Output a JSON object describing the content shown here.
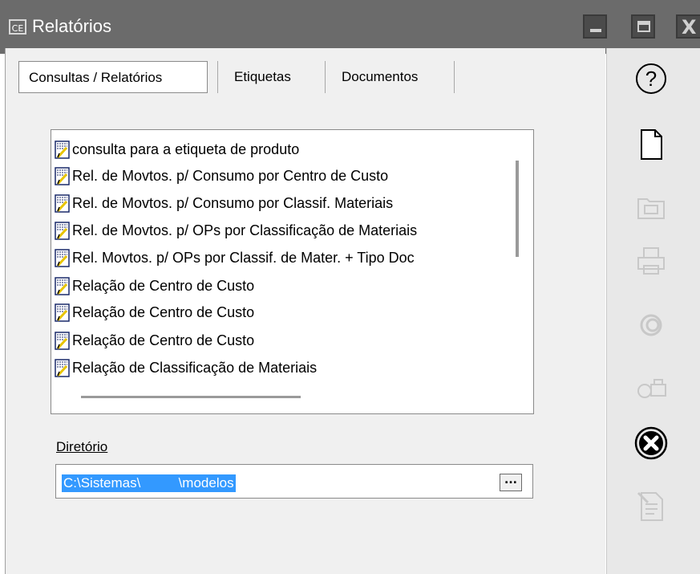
{
  "window": {
    "app_badge": "CE",
    "title": "Relatórios",
    "min_icon": "minimize-icon",
    "max_icon": "maximize-icon",
    "close_icon": "close-icon",
    "close_glyph": "X"
  },
  "tabs": [
    {
      "label": "Consultas / Relatórios",
      "active": true
    },
    {
      "label": "Etiquetas",
      "active": false
    },
    {
      "label": "Documentos",
      "active": false
    }
  ],
  "report_list": {
    "item_icon": "report-document-icon",
    "items": [
      "consulta para a etiqueta de produto",
      "Rel. de Movtos. p/ Consumo por Centro de Custo",
      "Rel. de Movtos. p/ Consumo por Classif. Materiais",
      "Rel. de Movtos. p/ OPs por Classificação de Materiais",
      "Rel. Movtos. p/  OPs por Classif. de Mater. + Tipo Doc",
      "Relação de Centro de Custo",
      "Relação de Centro de Custo",
      "Relação de Centro de Custo",
      "Relação de Classificação de Materiais"
    ]
  },
  "directory": {
    "label": "Diretório",
    "value": "C:\\Sistemas\\          \\modelos",
    "browse_label": "..."
  },
  "toolbar": {
    "buttons": [
      {
        "icon": "help-icon",
        "enabled": true
      },
      {
        "icon": "new-document-icon",
        "enabled": true
      },
      {
        "icon": "open-folder-icon",
        "enabled": false
      },
      {
        "icon": "print-icon",
        "enabled": false
      },
      {
        "icon": "preview-eye-icon",
        "enabled": false
      },
      {
        "icon": "preview-print-icon",
        "enabled": false
      },
      {
        "icon": "close-circle-icon",
        "enabled": true
      },
      {
        "icon": "edit-document-icon",
        "enabled": false
      }
    ]
  },
  "colors": {
    "titlebar": "#6b6b6b",
    "selection": "#3399ff",
    "panel": "#f0f0f0",
    "disabled_icon": "#c8c8c8"
  }
}
